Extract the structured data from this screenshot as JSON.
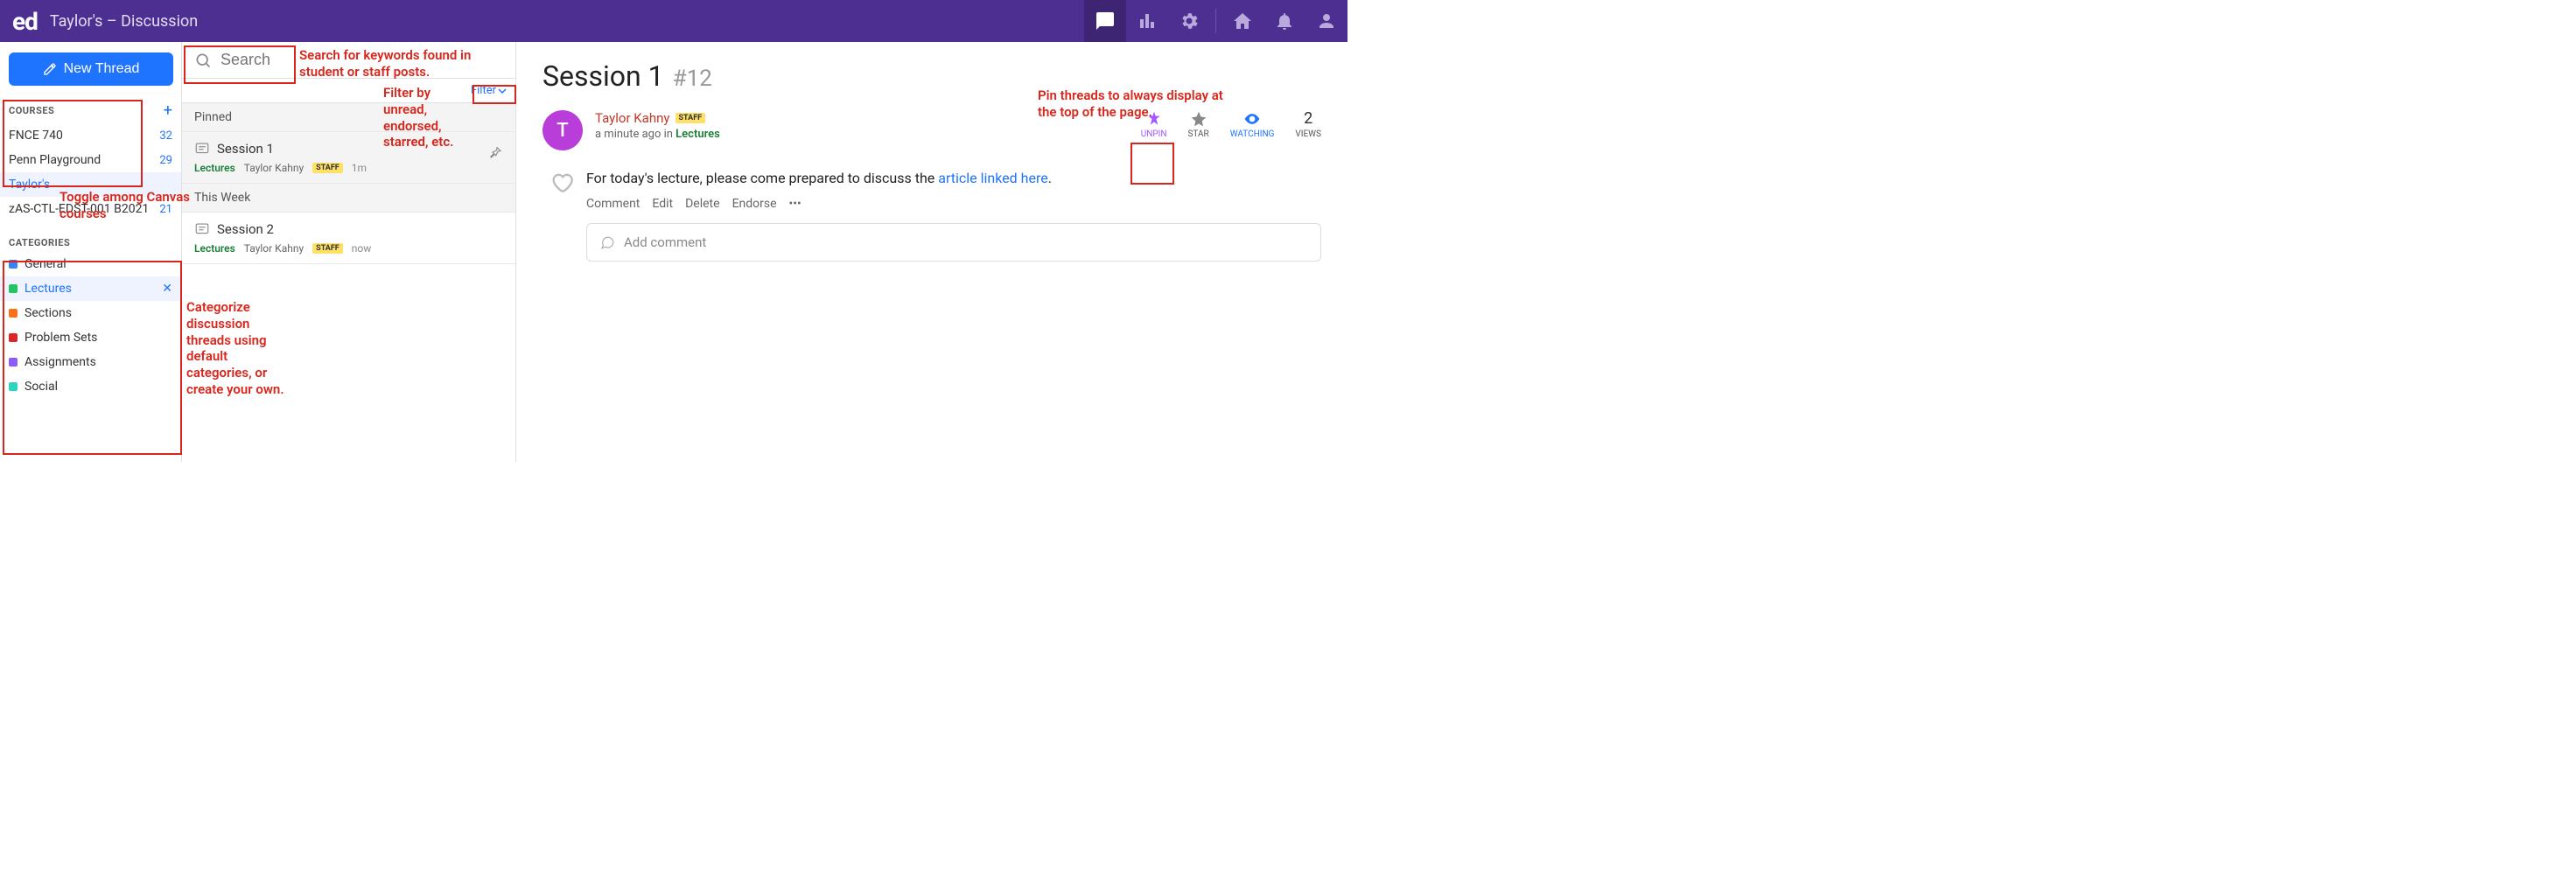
{
  "topbar": {
    "logo": "ed",
    "title": "Taylor's – Discussion"
  },
  "sidebar": {
    "new_thread": "New Thread",
    "courses_heading": "COURSES",
    "courses": [
      {
        "name": "FNCE 740",
        "count": "32"
      },
      {
        "name": "Penn Playground",
        "count": "29"
      },
      {
        "name": "Taylor's",
        "count": ""
      },
      {
        "name": "zAS-CTL-EDST-001 B2021",
        "count": "21"
      }
    ],
    "categories_heading": "CATEGORIES",
    "categories": [
      {
        "name": "General",
        "color": "#3b82f6"
      },
      {
        "name": "Lectures",
        "color": "#22c55e"
      },
      {
        "name": "Sections",
        "color": "#f97316"
      },
      {
        "name": "Problem Sets",
        "color": "#dc2626"
      },
      {
        "name": "Assignments",
        "color": "#8b5cf6"
      },
      {
        "name": "Social",
        "color": "#2dd4bf"
      }
    ]
  },
  "threadcol": {
    "search_placeholder": "Search",
    "filter_label": "Filter",
    "sections": [
      {
        "header": "Pinned",
        "items": [
          {
            "title": "Session 1",
            "category": "Lectures",
            "author": "Taylor Kahny",
            "badge": "STAFF",
            "time": "1m",
            "pinned": true
          }
        ]
      },
      {
        "header": "This Week",
        "items": [
          {
            "title": "Session 2",
            "category": "Lectures",
            "author": "Taylor Kahny",
            "badge": "STAFF",
            "time": "now",
            "pinned": false
          }
        ]
      }
    ]
  },
  "thread": {
    "title": "Session 1",
    "number": "#12",
    "avatar_initial": "T",
    "author": "Taylor Kahny",
    "badge": "STAFF",
    "meta_prefix": "a minute ago in ",
    "meta_category": "Lectures",
    "actions": {
      "unpin": "UNPIN",
      "star": "STAR",
      "watch": "WATCHING",
      "views_count": "2",
      "views_label": "VIEWS"
    },
    "body_text": "For today's lecture, please come prepared to discuss the ",
    "body_link": "article linked here",
    "body_suffix": ".",
    "post_actions": {
      "comment": "Comment",
      "edit": "Edit",
      "delete": "Delete",
      "endorse": "Endorse"
    },
    "comment_placeholder": "Add comment"
  },
  "annotations": {
    "search": "Search for keywords found in student or staff posts.",
    "filter": "Filter by unread, endorsed, starred, etc.",
    "courses": "Toggle among Canvas courses",
    "categories": "Categorize discussion threads using default categories, or create your own.",
    "pin": "Pin threads to always display at the top of the page."
  }
}
